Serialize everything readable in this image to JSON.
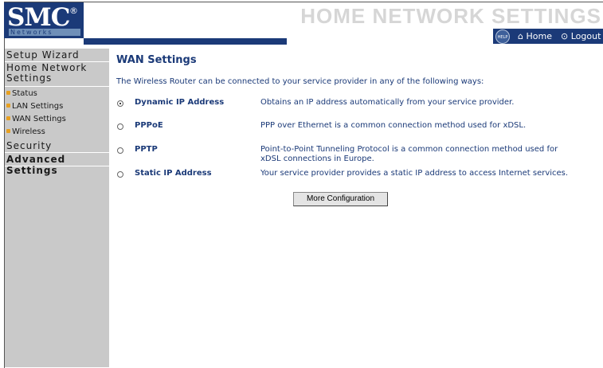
{
  "brand": {
    "name": "SMC",
    "registered": "®",
    "subtitle": "Networks"
  },
  "header": {
    "title": "HOME NETWORK SETTINGS",
    "help_label": "HELP",
    "home_label": "Home",
    "logout_label": "Logout"
  },
  "sidebar": {
    "setup_wizard": "Setup Wizard",
    "home_network": "Home Network Settings",
    "sub_items": [
      "Status",
      "LAN Settings",
      "WAN Settings",
      "Wireless"
    ],
    "security": "Security",
    "advanced": "Advanced Settings"
  },
  "main": {
    "title": "WAN Settings",
    "intro": "The Wireless Router can be connected to your service provider in any of the following ways:",
    "options": [
      {
        "label": "Dynamic IP Address",
        "desc": "Obtains an IP address automatically from your service provider.",
        "checked": true
      },
      {
        "label": "PPPoE",
        "desc": "PPP over Ethernet is a common connection method used for xDSL.",
        "checked": false
      },
      {
        "label": "PPTP",
        "desc": "Point-to-Point Tunneling Protocol is a common connection method used for xDSL connections in Europe.",
        "checked": false
      },
      {
        "label": "Static IP Address",
        "desc": "Your service provider provides a static IP address to access Internet services.",
        "checked": false
      }
    ],
    "button_label": "More Configuration"
  },
  "colors": {
    "brand_blue": "#1b3a78",
    "sidebar_gray": "#c9c9c9",
    "bullet_orange": "#e8a020"
  }
}
